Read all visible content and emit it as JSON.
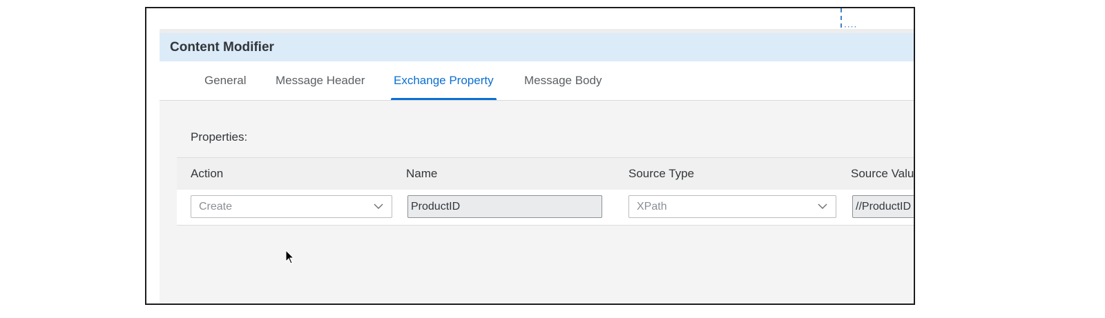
{
  "panel": {
    "title": "Content Modifier"
  },
  "tabs": [
    {
      "label": "General",
      "active": false
    },
    {
      "label": "Message Header",
      "active": false
    },
    {
      "label": "Exchange Property",
      "active": true
    },
    {
      "label": "Message Body",
      "active": false
    }
  ],
  "properties": {
    "section_label": "Properties:",
    "columns": [
      "Action",
      "Name",
      "Source Type",
      "Source Valu"
    ],
    "rows": [
      {
        "action": "Create",
        "name": "ProductID",
        "source_type": "XPath",
        "source_value": "//ProductID"
      }
    ]
  },
  "colors": {
    "accent": "#0a6ed1",
    "title_bar": "#dcebf8",
    "connector": "#3f7fc4"
  },
  "icons": {
    "dropdown": "chevron-down-icon",
    "connector": "dashed-connector-icon",
    "pointer": "mouse-cursor-icon"
  }
}
